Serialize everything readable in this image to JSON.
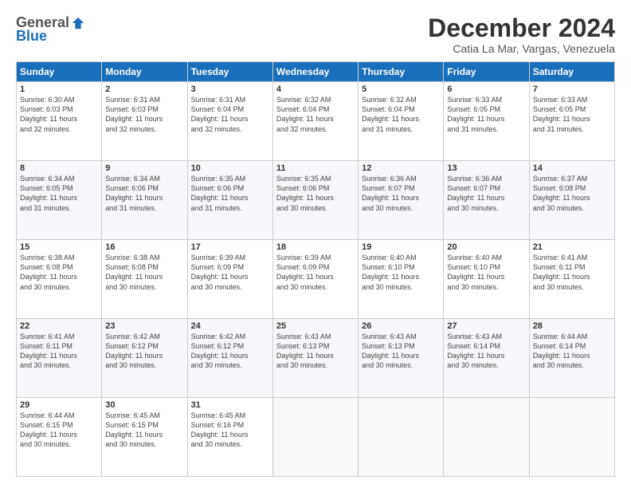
{
  "header": {
    "logo_general": "General",
    "logo_blue": "Blue",
    "month": "December 2024",
    "location": "Catia La Mar, Vargas, Venezuela"
  },
  "days_of_week": [
    "Sunday",
    "Monday",
    "Tuesday",
    "Wednesday",
    "Thursday",
    "Friday",
    "Saturday"
  ],
  "weeks": [
    [
      {
        "day": "1",
        "info": "Sunrise: 6:30 AM\nSunset: 6:03 PM\nDaylight: 11 hours\nand 32 minutes."
      },
      {
        "day": "2",
        "info": "Sunrise: 6:31 AM\nSunset: 6:03 PM\nDaylight: 11 hours\nand 32 minutes."
      },
      {
        "day": "3",
        "info": "Sunrise: 6:31 AM\nSunset: 6:04 PM\nDaylight: 11 hours\nand 32 minutes."
      },
      {
        "day": "4",
        "info": "Sunrise: 6:32 AM\nSunset: 6:04 PM\nDaylight: 11 hours\nand 32 minutes."
      },
      {
        "day": "5",
        "info": "Sunrise: 6:32 AM\nSunset: 6:04 PM\nDaylight: 11 hours\nand 31 minutes."
      },
      {
        "day": "6",
        "info": "Sunrise: 6:33 AM\nSunset: 6:05 PM\nDaylight: 11 hours\nand 31 minutes."
      },
      {
        "day": "7",
        "info": "Sunrise: 6:33 AM\nSunset: 6:05 PM\nDaylight: 11 hours\nand 31 minutes."
      }
    ],
    [
      {
        "day": "8",
        "info": "Sunrise: 6:34 AM\nSunset: 6:05 PM\nDaylight: 11 hours\nand 31 minutes."
      },
      {
        "day": "9",
        "info": "Sunrise: 6:34 AM\nSunset: 6:06 PM\nDaylight: 11 hours\nand 31 minutes."
      },
      {
        "day": "10",
        "info": "Sunrise: 6:35 AM\nSunset: 6:06 PM\nDaylight: 11 hours\nand 31 minutes."
      },
      {
        "day": "11",
        "info": "Sunrise: 6:35 AM\nSunset: 6:06 PM\nDaylight: 11 hours\nand 30 minutes."
      },
      {
        "day": "12",
        "info": "Sunrise: 6:36 AM\nSunset: 6:07 PM\nDaylight: 11 hours\nand 30 minutes."
      },
      {
        "day": "13",
        "info": "Sunrise: 6:36 AM\nSunset: 6:07 PM\nDaylight: 11 hours\nand 30 minutes."
      },
      {
        "day": "14",
        "info": "Sunrise: 6:37 AM\nSunset: 6:08 PM\nDaylight: 11 hours\nand 30 minutes."
      }
    ],
    [
      {
        "day": "15",
        "info": "Sunrise: 6:38 AM\nSunset: 6:08 PM\nDaylight: 11 hours\nand 30 minutes."
      },
      {
        "day": "16",
        "info": "Sunrise: 6:38 AM\nSunset: 6:08 PM\nDaylight: 11 hours\nand 30 minutes."
      },
      {
        "day": "17",
        "info": "Sunrise: 6:39 AM\nSunset: 6:09 PM\nDaylight: 11 hours\nand 30 minutes."
      },
      {
        "day": "18",
        "info": "Sunrise: 6:39 AM\nSunset: 6:09 PM\nDaylight: 11 hours\nand 30 minutes."
      },
      {
        "day": "19",
        "info": "Sunrise: 6:40 AM\nSunset: 6:10 PM\nDaylight: 11 hours\nand 30 minutes."
      },
      {
        "day": "20",
        "info": "Sunrise: 6:40 AM\nSunset: 6:10 PM\nDaylight: 11 hours\nand 30 minutes."
      },
      {
        "day": "21",
        "info": "Sunrise: 6:41 AM\nSunset: 6:11 PM\nDaylight: 11 hours\nand 30 minutes."
      }
    ],
    [
      {
        "day": "22",
        "info": "Sunrise: 6:41 AM\nSunset: 6:11 PM\nDaylight: 11 hours\nand 30 minutes."
      },
      {
        "day": "23",
        "info": "Sunrise: 6:42 AM\nSunset: 6:12 PM\nDaylight: 11 hours\nand 30 minutes."
      },
      {
        "day": "24",
        "info": "Sunrise: 6:42 AM\nSunset: 6:12 PM\nDaylight: 11 hours\nand 30 minutes."
      },
      {
        "day": "25",
        "info": "Sunrise: 6:43 AM\nSunset: 6:13 PM\nDaylight: 11 hours\nand 30 minutes."
      },
      {
        "day": "26",
        "info": "Sunrise: 6:43 AM\nSunset: 6:13 PM\nDaylight: 11 hours\nand 30 minutes."
      },
      {
        "day": "27",
        "info": "Sunrise: 6:43 AM\nSunset: 6:14 PM\nDaylight: 11 hours\nand 30 minutes."
      },
      {
        "day": "28",
        "info": "Sunrise: 6:44 AM\nSunset: 6:14 PM\nDaylight: 11 hours\nand 30 minutes."
      }
    ],
    [
      {
        "day": "29",
        "info": "Sunrise: 6:44 AM\nSunset: 6:15 PM\nDaylight: 11 hours\nand 30 minutes."
      },
      {
        "day": "30",
        "info": "Sunrise: 6:45 AM\nSunset: 6:15 PM\nDaylight: 11 hours\nand 30 minutes."
      },
      {
        "day": "31",
        "info": "Sunrise: 6:45 AM\nSunset: 6:16 PM\nDaylight: 11 hours\nand 30 minutes."
      },
      {
        "day": "",
        "info": ""
      },
      {
        "day": "",
        "info": ""
      },
      {
        "day": "",
        "info": ""
      },
      {
        "day": "",
        "info": ""
      }
    ]
  ]
}
